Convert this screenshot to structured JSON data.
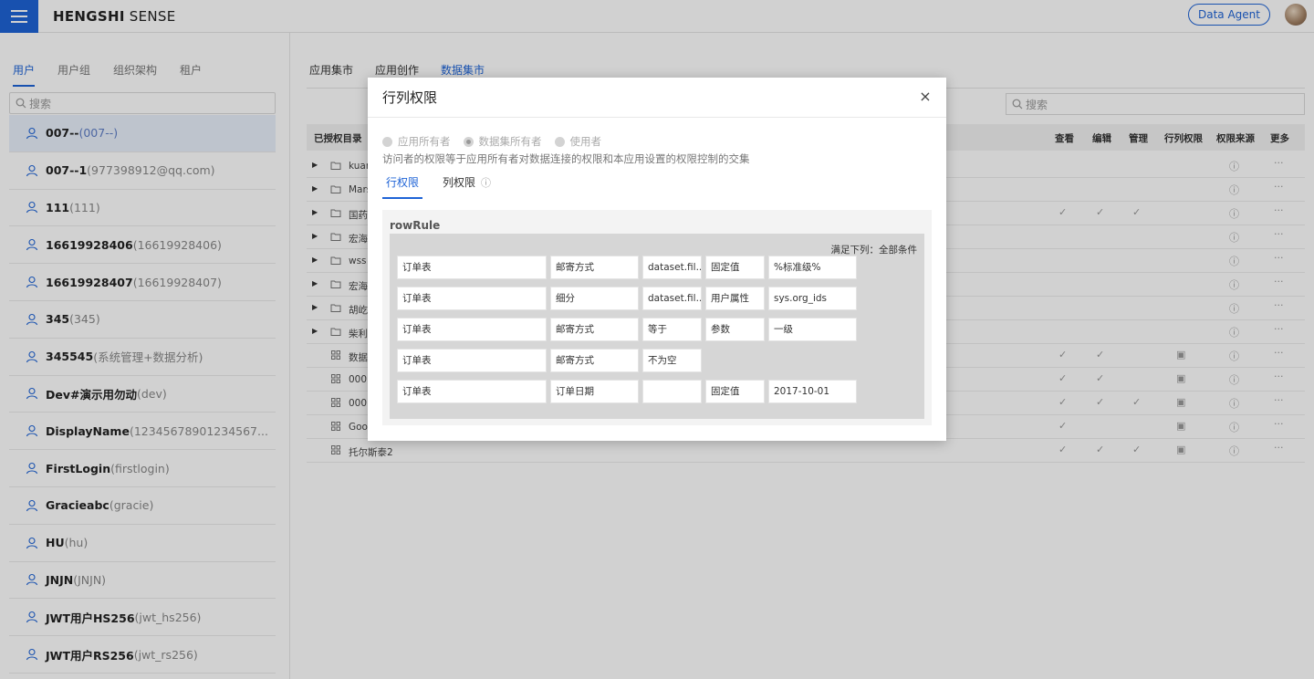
{
  "header": {
    "brand_bold": "HENGSHI",
    "brand_rest": " SENSE",
    "agent_label": "Data Agent"
  },
  "left": {
    "tabs": [
      "用户",
      "用户组",
      "组织架构",
      "租户"
    ],
    "search_placeholder": "搜索",
    "users": [
      {
        "name": "007--",
        "sub": "(007--)"
      },
      {
        "name": "007--1",
        "sub": "(977398912@qq.com)"
      },
      {
        "name": "111",
        "sub": "(111)"
      },
      {
        "name": "16619928406",
        "sub": "(16619928406)"
      },
      {
        "name": "16619928407",
        "sub": "(16619928407)"
      },
      {
        "name": "345",
        "sub": "(345)"
      },
      {
        "name": "345545",
        "sub": "(系统管理+数据分析)"
      },
      {
        "name": "Dev#演示用勿动",
        "sub": "(dev)"
      },
      {
        "name": "DisplayName",
        "sub": "(12345678901234567..."
      },
      {
        "name": "FirstLogin",
        "sub": "(firstlogin)"
      },
      {
        "name": "Gracieabc",
        "sub": "(gracie)"
      },
      {
        "name": "HU",
        "sub": "(hu)"
      },
      {
        "name": "JNJN",
        "sub": "(JNJN)"
      },
      {
        "name": "JWT用户HS256",
        "sub": "(jwt_hs256)"
      },
      {
        "name": "JWT用户RS256",
        "sub": "(jwt_rs256)"
      }
    ]
  },
  "main": {
    "tabs": [
      "应用集市",
      "应用创作",
      "数据集市"
    ],
    "search_placeholder": "搜索",
    "columns": {
      "catalog": "已授权目录",
      "view": "查看",
      "edit": "编辑",
      "manage": "管理",
      "rowcol": "行列权限",
      "source": "权限来源",
      "more": "更多"
    },
    "rows": [
      {
        "type": "folder",
        "label": "kuan",
        "view": "",
        "edit": "",
        "manage": "",
        "rowcol": ""
      },
      {
        "type": "folder",
        "label": "Mars",
        "view": "",
        "edit": "",
        "manage": "",
        "rowcol": ""
      },
      {
        "type": "folder",
        "label": "国药",
        "view": "✓",
        "edit": "✓",
        "manage": "✓",
        "rowcol": ""
      },
      {
        "type": "folder",
        "label": "宏海",
        "view": "",
        "edit": "",
        "manage": "",
        "rowcol": ""
      },
      {
        "type": "folder",
        "label": "wss",
        "view": "",
        "edit": "",
        "manage": "",
        "rowcol": ""
      },
      {
        "type": "folder",
        "label": "宏海",
        "view": "",
        "edit": "",
        "manage": "",
        "rowcol": ""
      },
      {
        "type": "folder",
        "label": "胡屹",
        "view": "",
        "edit": "",
        "manage": "",
        "rowcol": ""
      },
      {
        "type": "folder",
        "label": "柴利",
        "view": "",
        "edit": "",
        "manage": "",
        "rowcol": ""
      },
      {
        "type": "dataset",
        "label": "数据",
        "view": "✓",
        "edit": "✓",
        "manage": "",
        "rowcol": "▣"
      },
      {
        "type": "dataset",
        "label": "000",
        "view": "✓",
        "edit": "✓",
        "manage": "",
        "rowcol": "▣"
      },
      {
        "type": "dataset",
        "label": "0001",
        "view": "✓",
        "edit": "✓",
        "manage": "✓",
        "rowcol": "▣"
      },
      {
        "type": "dataset",
        "label": "Goo",
        "view": "✓",
        "edit": "",
        "manage": "",
        "rowcol": "▣"
      },
      {
        "type": "dataset",
        "label": "托尔斯泰2",
        "view": "✓",
        "edit": "✓",
        "manage": "✓",
        "rowcol": "▣"
      }
    ],
    "source_icon": "ⓘ",
    "more_icon": "···"
  },
  "modal": {
    "title": "行列权限",
    "close": "×",
    "radios": [
      "应用所有者",
      "数据集所有者",
      "使用者"
    ],
    "description": "访问者的权限等于应用所有者对数据连接的权限和本应用设置的权限控制的交集",
    "tabs": {
      "row": "行权限",
      "col": "列权限",
      "info": "ⓘ"
    },
    "rule_title": "rowRule",
    "condition": "满足下列：全部条件",
    "rules": [
      [
        "订单表",
        "邮寄方式",
        "dataset.fil...",
        "固定值",
        "%标准级%"
      ],
      [
        "订单表",
        "细分",
        "dataset.fil...",
        "用户属性",
        "sys.org_ids"
      ],
      [
        "订单表",
        "邮寄方式",
        "等于",
        "参数",
        "一级"
      ],
      [
        "订单表",
        "邮寄方式",
        "不为空"
      ],
      [
        "订单表",
        "订单日期",
        "",
        "固定值",
        "2017-10-01"
      ]
    ]
  }
}
